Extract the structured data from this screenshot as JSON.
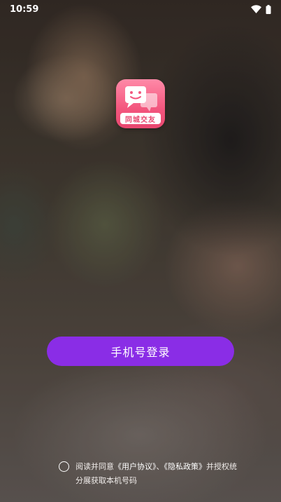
{
  "status_bar": {
    "time": "10:59"
  },
  "logo": {
    "label": "同城交友"
  },
  "login": {
    "button_label": "手机号登录"
  },
  "agreement": {
    "prefix": "阅读并同意",
    "user_agreement": "《用户协议》",
    "separator": "、",
    "privacy_policy": "《隐私政策》",
    "suffix": "并授权统分展获取本机号码"
  },
  "colors": {
    "accent": "#8a2de6",
    "logo": "#f3567e"
  }
}
